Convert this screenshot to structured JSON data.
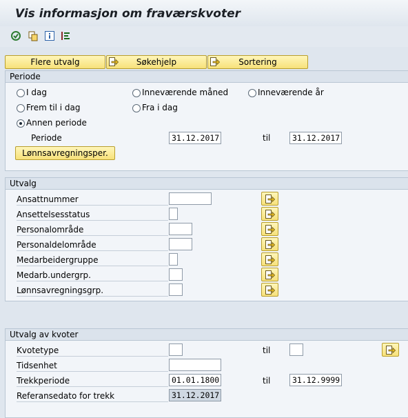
{
  "window": {
    "title": "Vis informasjon om fraværskvoter"
  },
  "toolbar": {
    "icons": [
      "execute-icon",
      "copy-variant-icon",
      "info-icon",
      "selection-options-icon"
    ]
  },
  "buttons": {
    "flere_utvalg": "Flere utvalg",
    "sokehjelp": "Søkehjelp",
    "sortering": "Sortering"
  },
  "periode": {
    "header": "Periode",
    "options": {
      "i_dag": "I dag",
      "innev_maaned": "Inneværende måned",
      "innev_aar": "Inneværende år",
      "frem_til_i_dag": "Frem til i dag",
      "fra_i_dag": "Fra i dag",
      "annen_periode": "Annen periode"
    },
    "selected": "Annen periode",
    "periode_label": "Periode",
    "from": "31.12.2017",
    "til_label": "til",
    "to": "31.12.2017",
    "lonnsperiode_button": "Lønnsavregningsper."
  },
  "utvalg": {
    "header": "Utvalg",
    "rows": [
      {
        "label": "Ansattnummer",
        "value": ""
      },
      {
        "label": "Ansettelsesstatus",
        "value": ""
      },
      {
        "label": "Personalområde",
        "value": ""
      },
      {
        "label": "Personaldelområde",
        "value": ""
      },
      {
        "label": "Medarbeidergruppe",
        "value": ""
      },
      {
        "label": "Medarb.undergrp.",
        "value": ""
      },
      {
        "label": "Lønnsavregningsgrp.",
        "value": ""
      }
    ]
  },
  "kvoter": {
    "header": "Utvalg av kvoter",
    "kvotetype_label": "Kvotetype",
    "kvotetype_from": "",
    "kvotetype_til_label": "til",
    "kvotetype_to": "",
    "tidsenhet_label": "Tidsenhet",
    "tidsenhet_value": "",
    "trekkperiode_label": "Trekkperiode",
    "trekkperiode_from": "01.01.1800",
    "trekkperiode_til_label": "til",
    "trekkperiode_to": "31.12.9999",
    "referansedato_label": "Referansedato for trekk",
    "referansedato_value": "31.12.2017"
  }
}
